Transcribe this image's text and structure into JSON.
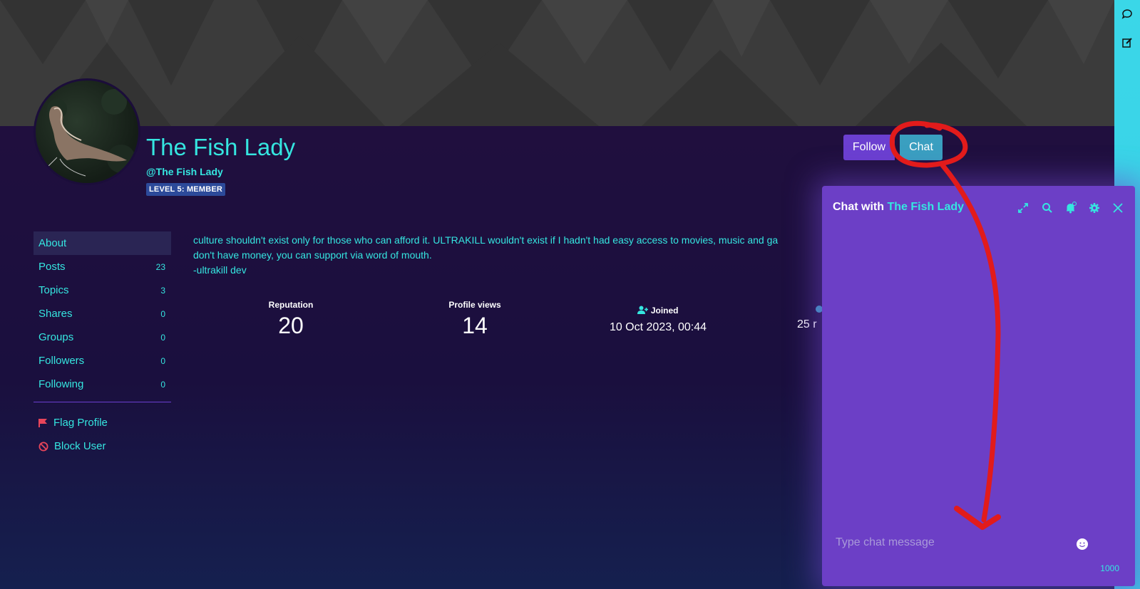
{
  "profile": {
    "display_name": "The Fish Lady",
    "handle": "@The Fish Lady",
    "level_badge": "LEVEL 5: MEMBER"
  },
  "actions": {
    "follow_label": "Follow",
    "chat_label": "Chat"
  },
  "nav": {
    "items": [
      {
        "label": "About",
        "count": ""
      },
      {
        "label": "Posts",
        "count": "23"
      },
      {
        "label": "Topics",
        "count": "3"
      },
      {
        "label": "Shares",
        "count": "0"
      },
      {
        "label": "Groups",
        "count": "0"
      },
      {
        "label": "Followers",
        "count": "0"
      },
      {
        "label": "Following",
        "count": "0"
      }
    ],
    "flag_label": "Flag Profile",
    "block_label": "Block User"
  },
  "about": {
    "line1": "culture shouldn't exist only for those who can afford it. ULTRAKILL wouldn't exist if I hadn't had easy access to movies, music and ga",
    "line2": "don't have money, you can support via word of mouth.",
    "line3": "-ultrakill dev"
  },
  "stats": {
    "reputation_label": "Reputation",
    "reputation_value": "20",
    "views_label": "Profile views",
    "views_value": "14",
    "joined_label": "Joined",
    "joined_value": "10 Oct 2023, 00:44",
    "partial_value": "25 r"
  },
  "chat": {
    "title_prefix": "Chat with",
    "title_name": "The Fish Lady",
    "input_placeholder": "Type chat message",
    "char_counter": "1000"
  },
  "colors": {
    "accent_cyan": "#35e6e0",
    "accent_purple": "#6b3fd0",
    "chat_panel": "#6c3fc6",
    "annotation_red": "#e21b1b"
  }
}
